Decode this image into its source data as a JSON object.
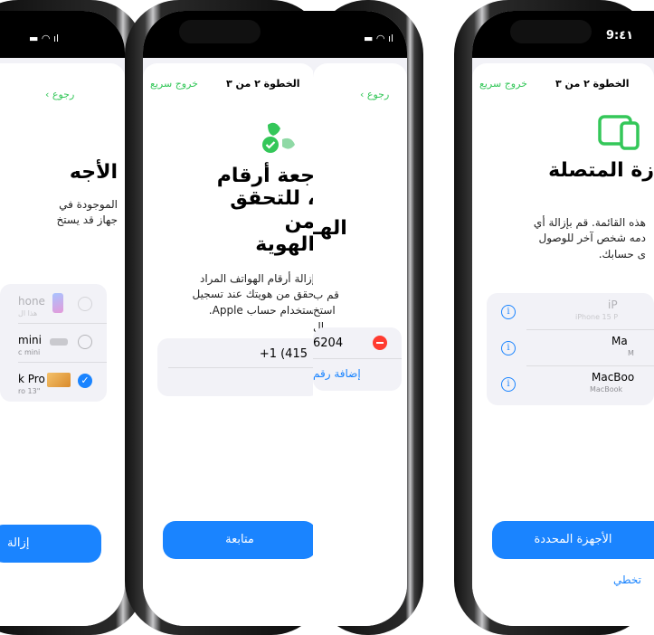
{
  "status": {
    "time": "9:٤١"
  },
  "nav": {
    "back": "‹ رجوع",
    "quick_exit": "خروج سريع",
    "center": "الخطوة ٢ من ٣"
  },
  "phone1": {
    "title": "الأجه",
    "description": "الموجودة في\nجهاز قد يستخ",
    "devices": [
      {
        "name": "hone",
        "sub": "هذا ال",
        "state": "dim"
      },
      {
        "name": "mini",
        "sub": "c mini",
        "state": "off"
      },
      {
        "name": "k Pro",
        "sub": "ro 13\"",
        "state": "on"
      }
    ],
    "button": "إزالة"
  },
  "phone2": {
    "title": "جعة أرقام\n، للتحقق من\nالهوية",
    "description": "إزالة أرقام الهواتف المراد\nحقق من هويتك عند تسجيل\nستخدام حساب Apple.",
    "phone_number": "+1 (415",
    "button": "متابعة"
  },
  "phone3": {
    "title": "الهـ",
    "description": "قم ب\nاستخ\nال",
    "phone_number": "6204",
    "add_number": "إضافة رقم"
  },
  "phone4": {
    "title": "زة المتصلة",
    "description": "هذه القائمة. قم بإزالة أي\nدمه شخص آخر للوصول\nى حسابك.",
    "devices": [
      {
        "name": "iP",
        "sub": "iPhone 15 P"
      },
      {
        "name": "Ma",
        "sub": "M"
      },
      {
        "name": "MacBoo",
        "sub": "MacBook"
      }
    ],
    "button": "الأجهزة المحددة",
    "skip": "تخطي"
  }
}
